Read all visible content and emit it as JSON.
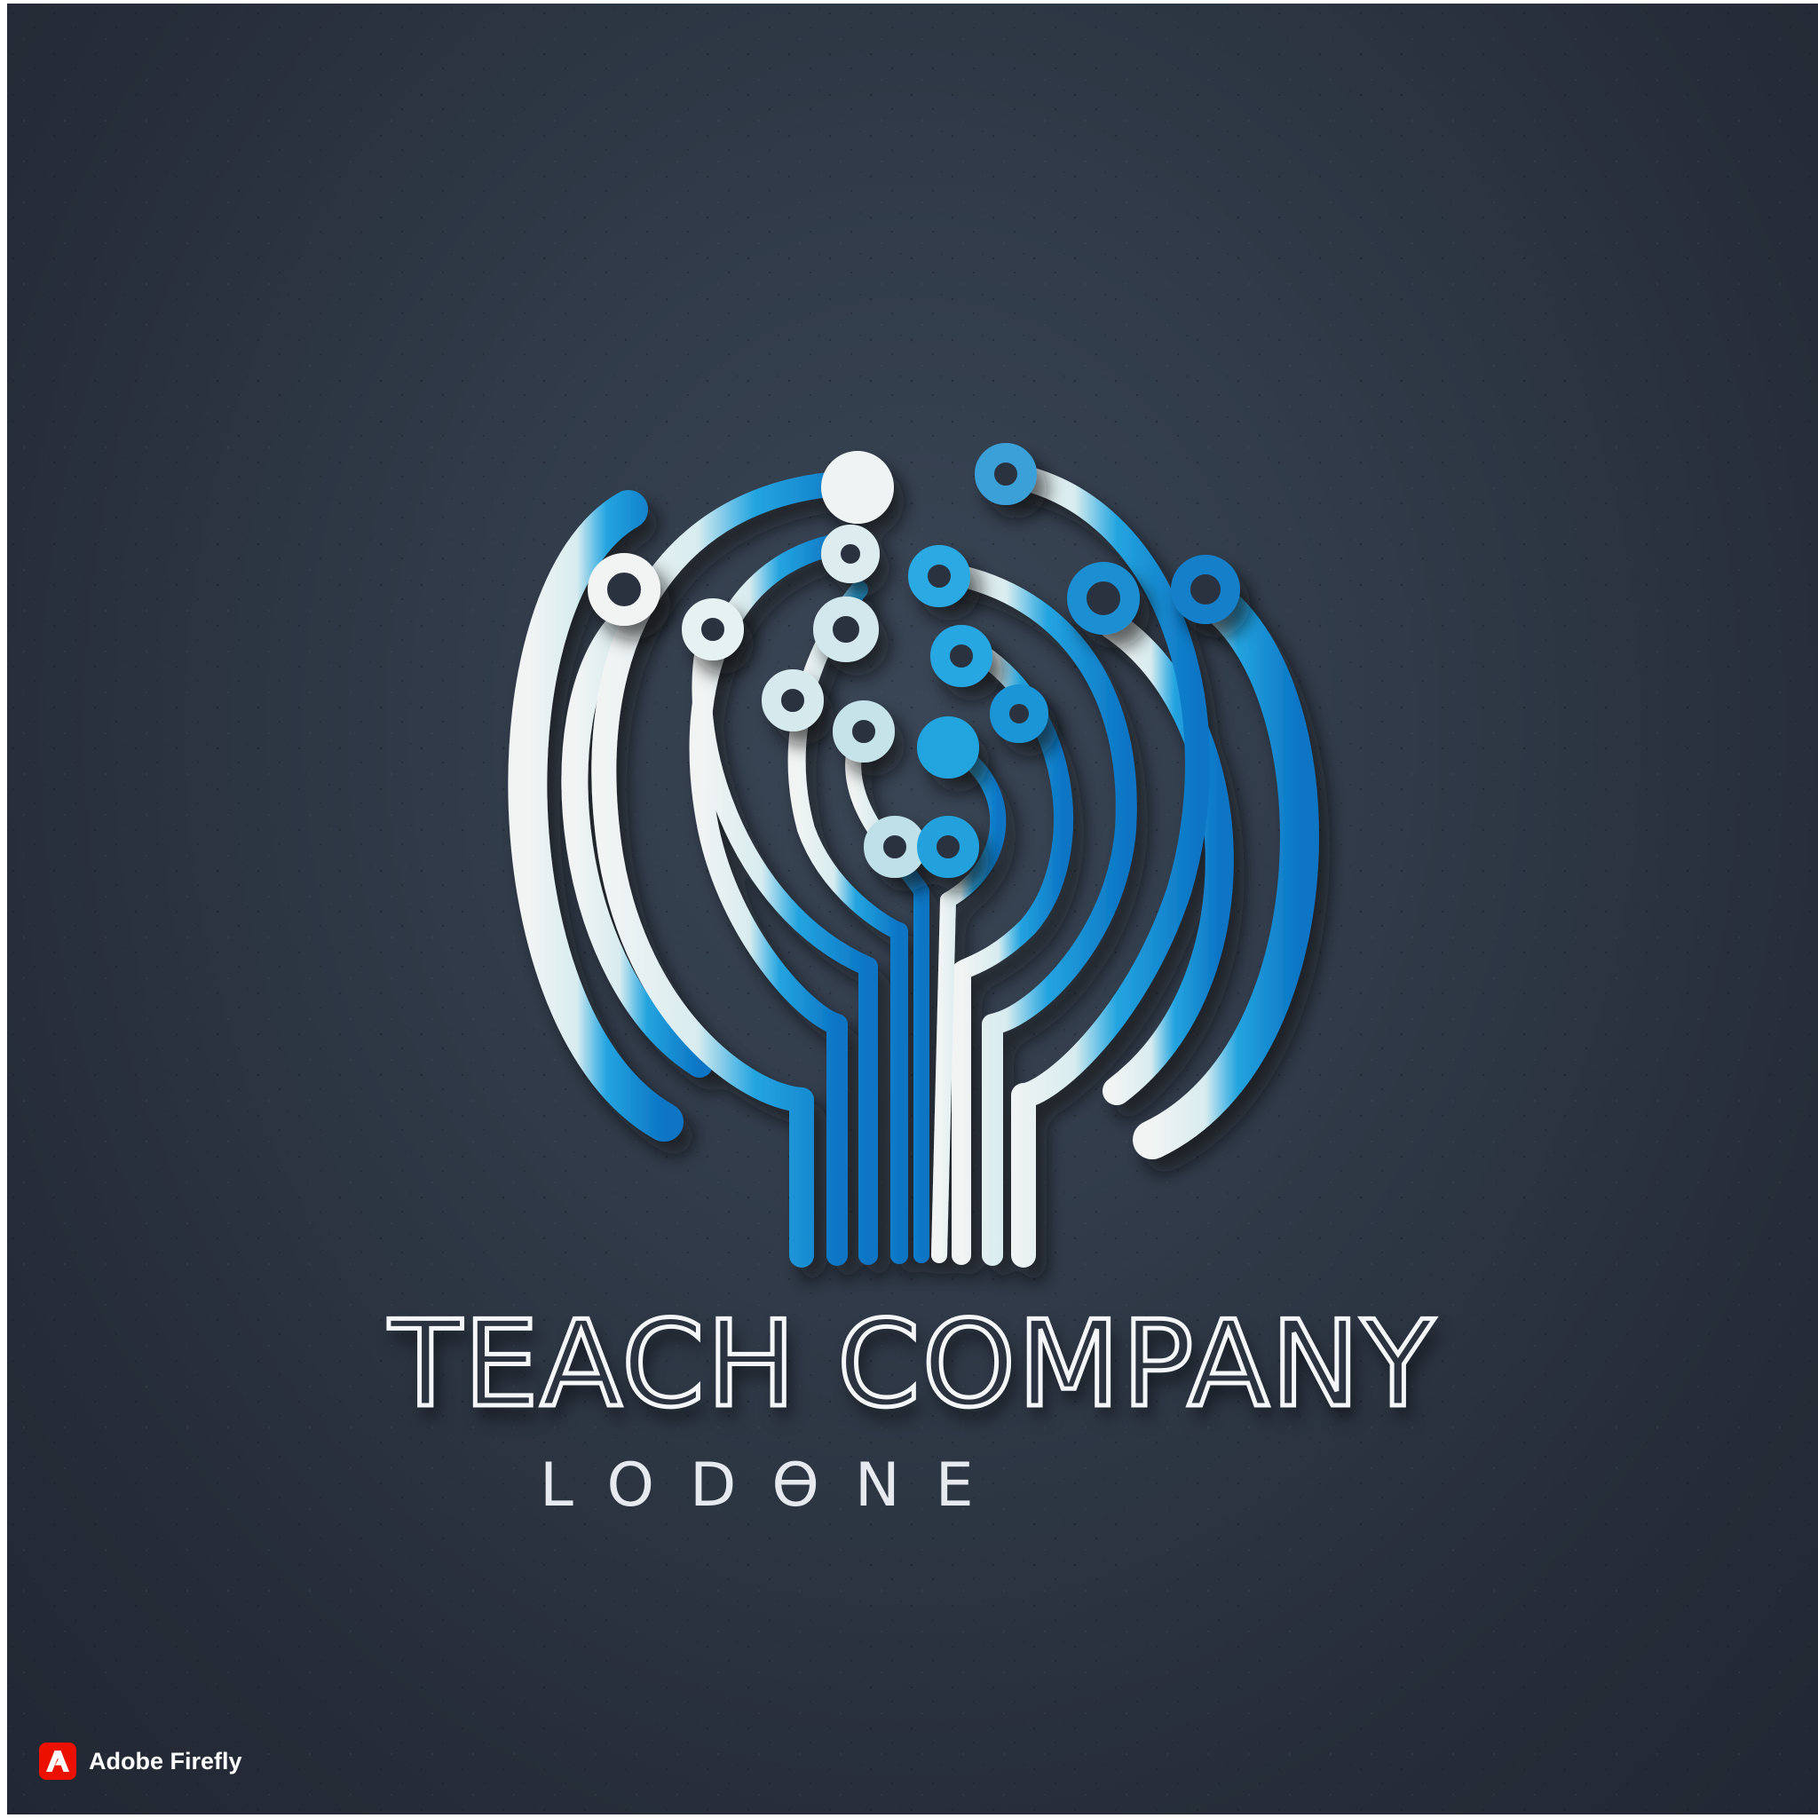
{
  "brand": {
    "name": "TEACH COMPANY",
    "tagline": "LODƟNE",
    "colors": {
      "background": "#2b333f",
      "mark_light": "#f2f4f4",
      "mark_mid": "#bfe0e8",
      "mark_blue": "#24a4df",
      "mark_deep_blue": "#0b74c4",
      "text": "#f4f6f8"
    },
    "icon": "circuit-tree-icon"
  },
  "watermark": {
    "text": "Adobe Firefly",
    "icon": "adobe-logo-icon",
    "color": "#eb1000"
  }
}
